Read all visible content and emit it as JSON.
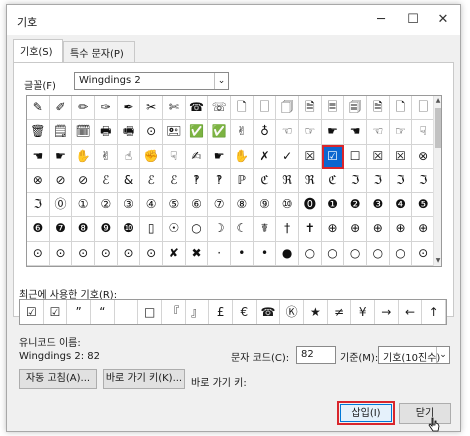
{
  "window": {
    "title": "기호",
    "minimize_icon": "minimize-icon",
    "maximize_icon": "maximize-icon",
    "close_icon": "close-icon"
  },
  "tabs": [
    {
      "label": "기호(S)"
    },
    {
      "label": "특수 문자(P)"
    }
  ],
  "font": {
    "label": "글꼴(F)",
    "value": "Wingdings 2"
  },
  "symbols": [
    [
      "✎",
      "✐",
      "✏",
      "✑",
      "✒",
      "✂",
      "✄",
      "☎",
      "☏",
      "🗋",
      "🗌",
      "🗍",
      "🗎",
      "🗏",
      "🗐",
      "🗎",
      "🗋",
      "🗌"
    ],
    [
      "🗑",
      "🗒",
      "🗓",
      "🖶",
      "🖷",
      "⊙",
      "🖭",
      "✅",
      "✅",
      "✌",
      "♁",
      "☜",
      "☞",
      "☛",
      "☚",
      "☜",
      "☞",
      "☟"
    ],
    [
      "☚",
      "☛",
      "✋",
      "✌",
      "☝",
      "✊",
      "☟",
      "✍",
      "☛",
      "✋",
      "✗",
      "✓",
      "☒",
      "☑",
      "☐",
      "☒",
      "☒",
      "⊗"
    ],
    [
      "⊗",
      "⊘",
      "⊘",
      "ℰ",
      "&",
      "ℰ",
      "ℰ",
      "‽",
      "‽",
      "ℙ",
      "ℭ",
      "ℜ",
      "ℜ",
      "ℭ",
      "ℑ",
      "ℑ",
      "ℑ",
      "ℑ"
    ],
    [
      "ℑ",
      "⓪",
      "①",
      "②",
      "③",
      "④",
      "⑤",
      "⑥",
      "⑦",
      "⑧",
      "⑨",
      "⑩",
      "⓿",
      "❶",
      "❷",
      "❸",
      "❹",
      "❺"
    ],
    [
      "❻",
      "❼",
      "❽",
      "❾",
      "❿",
      "▯",
      "☉",
      "○",
      "☽",
      "☾",
      "☤",
      "†",
      "✝",
      "⊕",
      "⊕",
      "⊕",
      "⊕",
      "⊕"
    ],
    [
      "⊙",
      "⊙",
      "⊙",
      "⊙",
      "⊙",
      "⊙",
      "✘",
      "✖",
      "·",
      "•",
      "•",
      "●",
      "○",
      "○",
      "○",
      "○",
      "○",
      "⊙"
    ]
  ],
  "selected": {
    "row": 2,
    "col": 13
  },
  "recent": {
    "label": "최근에 사용한 기호(R):",
    "items": [
      "☑",
      "☑",
      "”",
      "“",
      " ",
      "□",
      "『",
      "』",
      "£",
      "€",
      "☎",
      "Ⓚ",
      "★",
      "≠",
      "¥",
      "→",
      "←",
      "↑"
    ]
  },
  "unicode": {
    "label": "유니코드 이름:",
    "value": "Wingdings 2: 82"
  },
  "code": {
    "label": "문자 코드(C):",
    "value": "82"
  },
  "base": {
    "label": "기준(M):",
    "value": "기호(10진수)"
  },
  "buttons": {
    "autocorrect": "자동 고침(A)...",
    "shortcut": "바로 가기 키(K)...",
    "shortcut_label": "바로 가기 키:",
    "insert": "삽입(I)",
    "close": "닫기"
  },
  "colors": {
    "accent": "#0b66d0",
    "highlight": "#d9262c"
  }
}
